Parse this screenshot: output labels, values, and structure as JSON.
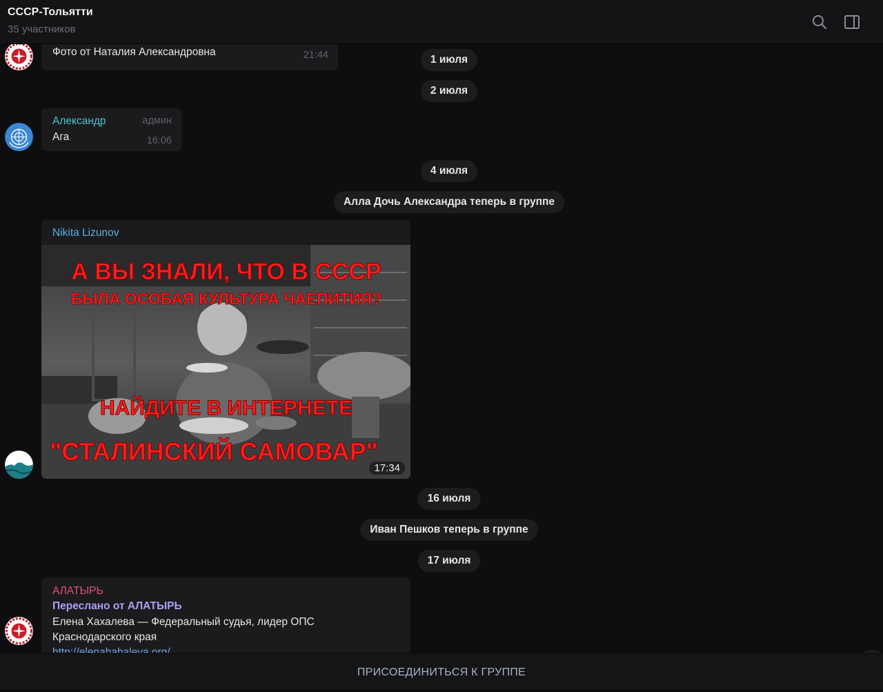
{
  "header": {
    "title": "СССР-Тольятти",
    "subtitle": "35 участников"
  },
  "messages": {
    "m1": {
      "text": "Фото от Наталия Александровна",
      "time": "21:44"
    },
    "d1": "1 июля",
    "d2": "2 июля",
    "m2": {
      "sender": "Александр",
      "badge": "админ",
      "text": "Ага",
      "time": "16:06"
    },
    "d3": "4 июля",
    "s1": "Алла Дочь Александра теперь в группе",
    "m3": {
      "sender": "Nikita Lizunov",
      "time": "17:34",
      "image_caption_line1": "А ВЫ ЗНАЛИ, ЧТО В СССР",
      "image_caption_line2": "БЫЛА ОСОБАЯ КУЛЬТУРА ЧАЕПИТИЯ?",
      "image_caption_line3": "НАЙДИТЕ В ИНТЕРНЕТЕ",
      "image_caption_line4": "\"СТАЛИНСКИЙ САМОВАР\""
    },
    "d4": "16 июля",
    "s2": "Иван Пешков теперь в группе",
    "d5": "17 июля",
    "m4": {
      "sender": "АЛАТЫРЬ",
      "forwarded": "Переслано от АЛАТЫРЬ",
      "line1": "Елена Хахалева — Федеральный судья, лидер ОПС",
      "line2": "Краснодарского края",
      "link": "http://elenahahaleva.org/"
    }
  },
  "footer": {
    "join_label": "ПРИСОЕДИНИТЬСЯ К ГРУППЕ"
  },
  "colors": {
    "sender_blue": "#5bb0e0",
    "sender_teal": "#4fc6d2",
    "sender_pink": "#e5507c",
    "forward": "#a9a1f2",
    "link": "#6ea6e8"
  }
}
